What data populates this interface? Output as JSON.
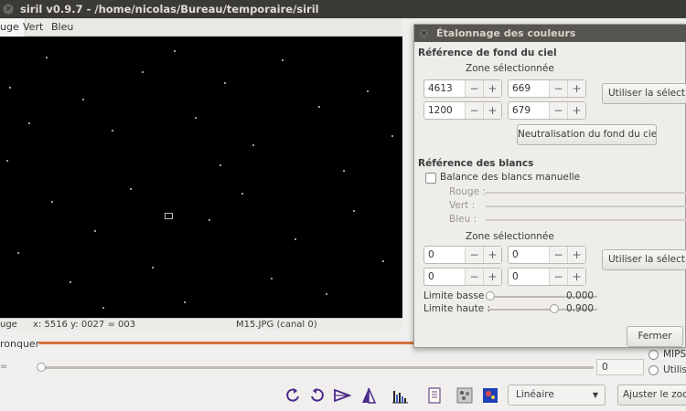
{
  "window": {
    "title": "siril v0.9.7 - /home/nicolas/Bureau/temporaire/siril"
  },
  "tabs": [
    {
      "label": "uge"
    },
    {
      "label": "Vert"
    },
    {
      "label": "Bleu"
    }
  ],
  "status": {
    "channel_short": "uge",
    "coords": "x: 5516 y: 0027 = 003",
    "filename": "M15.JPG (canal 0)"
  },
  "lower": {
    "tronquer_label": "ronquer",
    "slider_label": "=",
    "slider_value": "0",
    "radio_mips": "MIPS",
    "radio_utilis": "Utilis",
    "mode_combo": "Linéaire",
    "zoom_button": "Ajuster le zoom"
  },
  "toolbar_icons": [
    "rotate-ccw-icon",
    "rotate-cw-icon",
    "mirror-x-icon",
    "mirror-y-icon",
    "histogram-icon",
    "document-icon",
    "grid-icon",
    "color-map-icon"
  ],
  "dialog": {
    "title": "Étalonnage des couleurs",
    "bg_section_title": "Référence de fond du ciel",
    "bg_zone_label": "Zone sélectionnée",
    "bg_spins": [
      "4613",
      "669",
      "1200",
      "679"
    ],
    "bg_use_selection": "Utiliser la sélection",
    "neutralize_button": "Neutralisation du fond du ciel",
    "white_section_title": "Référence des blancs",
    "manual_white_balance": "Balance des blancs manuelle",
    "rouge": "Rouge :",
    "vert": "Vert :",
    "bleu": "Bleu :",
    "white_zone_label": "Zone sélectionnée",
    "white_spins": [
      "0",
      "0",
      "0",
      "0"
    ],
    "white_use_selection": "Utiliser la sélection",
    "low_limit_label": "Limite basse :",
    "low_limit_value": "0.000",
    "high_limit_label": "Limite haute :",
    "high_limit_value": "0.900",
    "close_button": "Fermer"
  },
  "colors": {
    "accent_orange": "#d5713f",
    "titlebar": "#3b3a36",
    "dialog_titlebar": "#57554f",
    "sky": "#000000"
  }
}
